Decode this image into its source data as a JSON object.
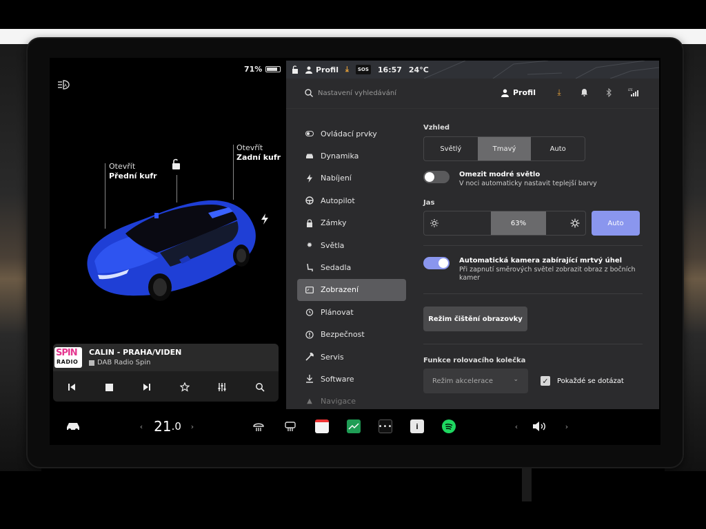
{
  "status": {
    "battery_percent": "71%",
    "battery_level": 0.71,
    "profile_label": "Profil",
    "sos_label": "SOS",
    "time": "16:57",
    "outside_temp": "24°C"
  },
  "left": {
    "callout_front_line1": "Otevřít",
    "callout_front_line2": "Přední kufr",
    "callout_rear_line1": "Otevřít",
    "callout_rear_line2": "Zadní kufr"
  },
  "media": {
    "logo_top": "SPIN",
    "logo_bottom": "RADIO",
    "title": "CALIN - PRAHA/VIDEN",
    "source": "DAB Radio Spin"
  },
  "search": {
    "placeholder": "Nastavení vyhledávání"
  },
  "header": {
    "profile_label": "Profil"
  },
  "menu": {
    "items": [
      {
        "label": "Ovládací prvky"
      },
      {
        "label": "Dynamika"
      },
      {
        "label": "Nabíjení"
      },
      {
        "label": "Autopilot"
      },
      {
        "label": "Zámky"
      },
      {
        "label": "Světla"
      },
      {
        "label": "Sedadla"
      },
      {
        "label": "Zobrazení"
      },
      {
        "label": "Plánovat"
      },
      {
        "label": "Bezpečnost"
      },
      {
        "label": "Servis"
      },
      {
        "label": "Software"
      },
      {
        "label": "Navigace"
      }
    ],
    "active_index": 7
  },
  "display": {
    "appearance_label": "Vzhled",
    "appearance_options": [
      "Světlý",
      "Tmavý",
      "Auto"
    ],
    "appearance_selected": 1,
    "blue_light_title": "Omezit modré světlo",
    "blue_light_sub": "V noci automaticky nastavit teplejší barvy",
    "brightness_label": "Jas",
    "brightness_value": "63%",
    "brightness_auto_label": "Auto",
    "blindspot_title": "Automatická kamera zabírající mrtvý úhel",
    "blindspot_sub": "Při zapnutí směrových světel zobrazit obraz z bočních kamer",
    "clean_button": "Režim čištění obrazovky",
    "scroll_wheel_label": "Funkce rolovacího kolečka",
    "scroll_wheel_value": "Režim akcelerace",
    "ask_every_time": "Pokaždé se dotázat"
  },
  "dock": {
    "cabin_temp_whole": "21",
    "cabin_temp_decimal": ".0"
  },
  "colors": {
    "accent": "#8a96ee",
    "download": "#e8a33a",
    "car_blue": "#1f3fd6"
  }
}
